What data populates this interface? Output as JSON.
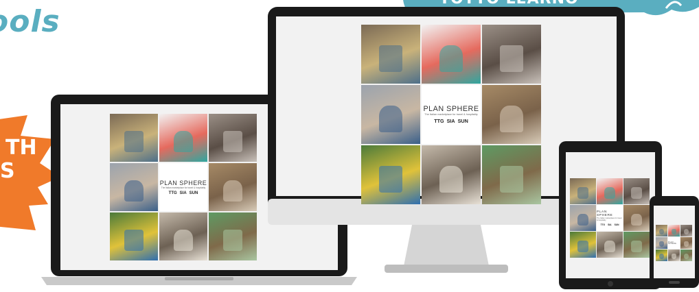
{
  "heading": {
    "text": "ools"
  },
  "banner": {
    "text": "TOTTO LEARNO",
    "color": "#5aaec0"
  },
  "badge": {
    "line1": "TH",
    "line2": "S",
    "color": "#f07a2a"
  },
  "logo": {
    "brand": "PLAN SPHERE",
    "tagline": "The Italian marketplace for travel & hospitality",
    "marks": [
      "TTG",
      "SIA",
      "SUN"
    ]
  },
  "tiles": [
    {
      "name": "photo-pool-ladder",
      "colors": [
        "#7b6a55",
        "#c9b27a",
        "#4d6f8a"
      ]
    },
    {
      "name": "photo-pink-chair",
      "colors": [
        "#f2f2f2",
        "#e56a5e",
        "#2fa7a0"
      ]
    },
    {
      "name": "photo-lounge",
      "colors": [
        "#9a8f86",
        "#5a4e46",
        "#c9c1ba"
      ]
    },
    {
      "name": "photo-exhibition-hall",
      "colors": [
        "#9ba3ad",
        "#c8b7a3",
        "#3a5f8a"
      ]
    },
    {
      "name": "logo-tile",
      "colors": [
        "#ffffff"
      ]
    },
    {
      "name": "photo-wooden-cabin",
      "colors": [
        "#a68a66",
        "#7a624a",
        "#d8cbb8"
      ]
    },
    {
      "name": "photo-playground",
      "colors": [
        "#4b7a3a",
        "#e0c23a",
        "#2f6fb0"
      ]
    },
    {
      "name": "photo-house-model",
      "colors": [
        "#c4b9aa",
        "#6d6154",
        "#e8e1d6"
      ]
    },
    {
      "name": "photo-green-wall",
      "colors": [
        "#5e9a63",
        "#7f6a4a",
        "#a9c6a1"
      ]
    }
  ]
}
